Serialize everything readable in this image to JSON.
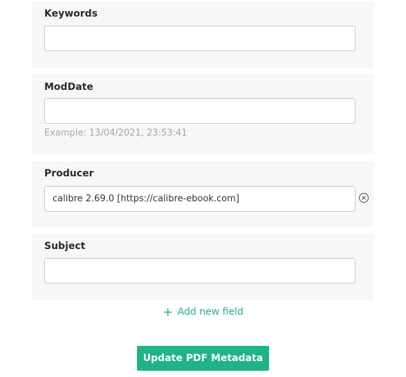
{
  "fields": {
    "keywords": {
      "label": "Keywords",
      "value": ""
    },
    "moddate": {
      "label": "ModDate",
      "value": "",
      "hint": "Example: 13/04/2021, 23:53:41"
    },
    "producer": {
      "label": "Producer",
      "value": "calibre 2.69.0 [https://calibre-ebook.com]"
    },
    "subject": {
      "label": "Subject",
      "value": ""
    }
  },
  "actions": {
    "add_field_icon": "+",
    "add_field_label": "Add new field",
    "update_label": "Update PDF Metadata"
  },
  "colors": {
    "accent": "#1db585",
    "link": "#27ae84",
    "panel_bg": "#f7f7f7",
    "hint": "#a6a6a6"
  },
  "icons": {
    "remove": "circle-x-icon",
    "add": "plus-icon"
  }
}
